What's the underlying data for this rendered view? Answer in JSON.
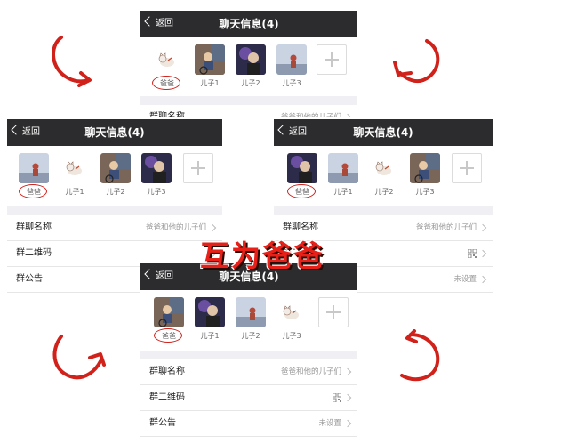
{
  "back_label": "返回",
  "title": "聊天信息(4)",
  "banner": "互为爸爸",
  "members": {
    "dad": "爸爸",
    "son1": "儿子1",
    "son2": "儿子2",
    "son3": "儿子3"
  },
  "settings": {
    "group_name_label": "群聊名称",
    "group_name_value": "爸爸和他的儿子们",
    "qr_label": "群二维码",
    "notice_label": "群公告",
    "notice_value": "未设置"
  },
  "colors": {
    "header": "#2c2c2e",
    "accent_red": "#d0211a"
  }
}
